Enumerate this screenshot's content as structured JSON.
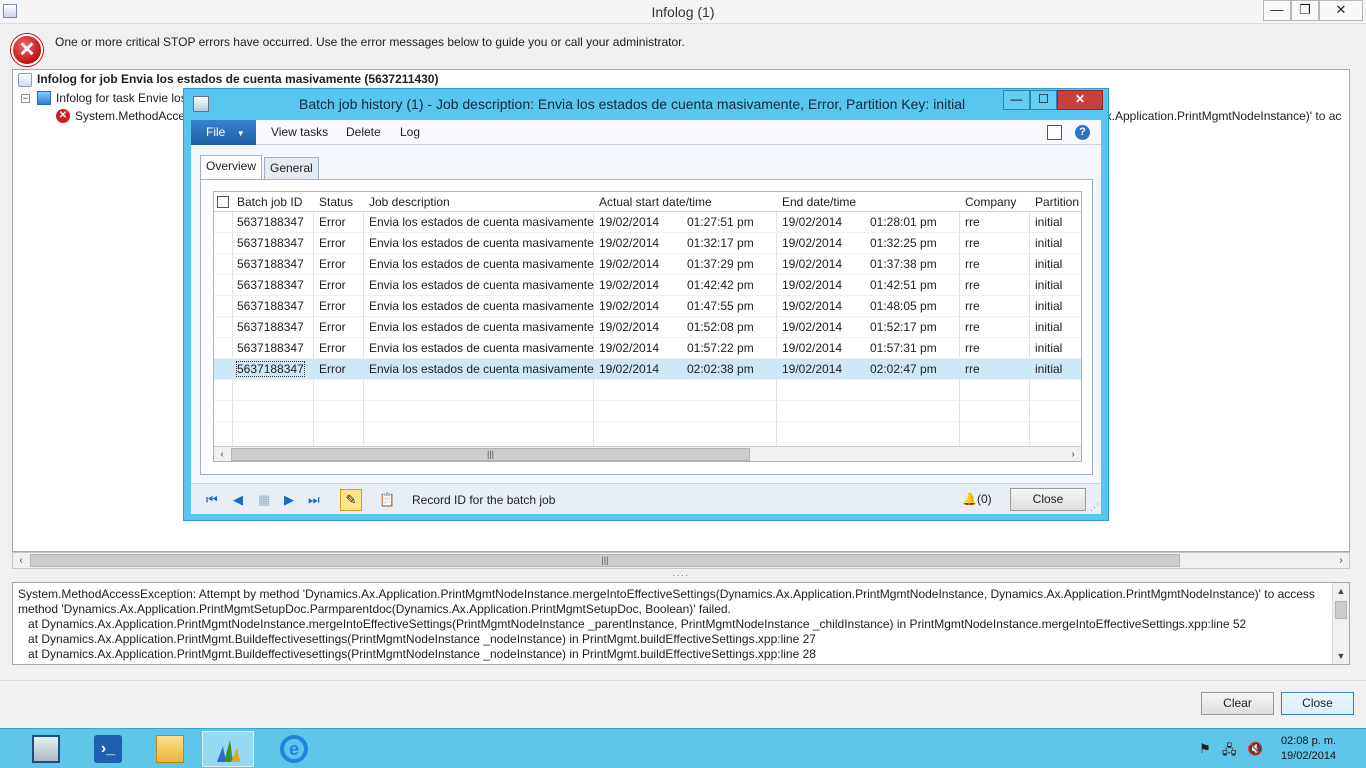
{
  "window": {
    "title": "Infolog (1)",
    "min_glyph": "—",
    "max_glyph": "❐",
    "close_glyph": "✕"
  },
  "stop_message": "One or more critical STOP errors have occurred. Use the error messages below to guide you or call your administrator.",
  "tree": {
    "job_node": "Infolog for job Envia los estados de cuenta masivamente (5637211430)",
    "task_node": "Infolog for task Envie los",
    "error_node": "System.MethodAccess",
    "error_tail": "ax.Application.PrintMgmtNodeInstance)' to ac"
  },
  "details": {
    "text": "System.MethodAccessException: Attempt by method 'Dynamics.Ax.Application.PrintMgmtNodeInstance.mergeIntoEffectiveSettings(Dynamics.Ax.Application.PrintMgmtNodeInstance, Dynamics.Ax.Application.PrintMgmtNodeInstance)' to access\nmethod 'Dynamics.Ax.Application.PrintMgmtSetupDoc.Parmparentdoc(Dynamics.Ax.Application.PrintMgmtSetupDoc, Boolean)' failed.\n   at Dynamics.Ax.Application.PrintMgmtNodeInstance.mergeIntoEffectiveSettings(PrintMgmtNodeInstance _parentInstance, PrintMgmtNodeInstance _childInstance) in PrintMgmtNodeInstance.mergeIntoEffectiveSettings.xpp:line 52\n   at Dynamics.Ax.Application.PrintMgmt.Buildeffectivesettings(PrintMgmtNodeInstance _nodeInstance) in PrintMgmt.buildEffectiveSettings.xpp:line 27\n   at Dynamics.Ax.Application.PrintMgmt.Buildeffectivesettings(PrintMgmtNodeInstance _nodeInstance) in PrintMgmt.buildEffectiveSettings.xpp:line 28"
  },
  "buttons": {
    "clear": "Clear",
    "close": "Close"
  },
  "dialog": {
    "title": "Batch job history (1) - Job description: Envia los estados de cuenta masivamente, Error, Partition Key: initial",
    "min_glyph": "—",
    "max_glyph": "☐",
    "close_glyph": "✕",
    "ribbon": {
      "file": "File",
      "file_arrow": "▼",
      "view_tasks": "View tasks",
      "delete": "Delete",
      "log": "Log",
      "help": "?"
    },
    "tabs": {
      "overview": "Overview",
      "general": "General"
    },
    "columns": {
      "batch_job_id": "Batch job ID",
      "status": "Status",
      "job_description": "Job description",
      "actual_start": "Actual start date/time",
      "end": "End date/time",
      "company": "Company",
      "partition": "Partition"
    },
    "rows": [
      {
        "id": "5637188347",
        "status": "Error",
        "desc": "Envia los estados de cuenta masivamente",
        "start_date": "19/02/2014",
        "start_time": "01:27:51 pm",
        "end_date": "19/02/2014",
        "end_time": "01:28:01 pm",
        "company": "rre",
        "partition": "initial"
      },
      {
        "id": "5637188347",
        "status": "Error",
        "desc": "Envia los estados de cuenta masivamente",
        "start_date": "19/02/2014",
        "start_time": "01:32:17 pm",
        "end_date": "19/02/2014",
        "end_time": "01:32:25 pm",
        "company": "rre",
        "partition": "initial"
      },
      {
        "id": "5637188347",
        "status": "Error",
        "desc": "Envia los estados de cuenta masivamente",
        "start_date": "19/02/2014",
        "start_time": "01:37:29 pm",
        "end_date": "19/02/2014",
        "end_time": "01:37:38 pm",
        "company": "rre",
        "partition": "initial"
      },
      {
        "id": "5637188347",
        "status": "Error",
        "desc": "Envia los estados de cuenta masivamente",
        "start_date": "19/02/2014",
        "start_time": "01:42:42 pm",
        "end_date": "19/02/2014",
        "end_time": "01:42:51 pm",
        "company": "rre",
        "partition": "initial"
      },
      {
        "id": "5637188347",
        "status": "Error",
        "desc": "Envia los estados de cuenta masivamente",
        "start_date": "19/02/2014",
        "start_time": "01:47:55 pm",
        "end_date": "19/02/2014",
        "end_time": "01:48:05 pm",
        "company": "rre",
        "partition": "initial"
      },
      {
        "id": "5637188347",
        "status": "Error",
        "desc": "Envia los estados de cuenta masivamente",
        "start_date": "19/02/2014",
        "start_time": "01:52:08 pm",
        "end_date": "19/02/2014",
        "end_time": "01:52:17 pm",
        "company": "rre",
        "partition": "initial"
      },
      {
        "id": "5637188347",
        "status": "Error",
        "desc": "Envia los estados de cuenta masivamente",
        "start_date": "19/02/2014",
        "start_time": "01:57:22 pm",
        "end_date": "19/02/2014",
        "end_time": "01:57:31 pm",
        "company": "rre",
        "partition": "initial"
      },
      {
        "id": "5637188347",
        "status": "Error",
        "desc": "Envia los estados de cuenta masivamente",
        "start_date": "19/02/2014",
        "start_time": "02:02:38 pm",
        "end_date": "19/02/2014",
        "end_time": "02:02:47 pm",
        "company": "rre",
        "partition": "initial"
      }
    ],
    "selected_row": 7,
    "status_text": "Record ID for the batch job",
    "notifications": "(0)",
    "close": "Close"
  },
  "taskbar": {
    "items": [
      "server-manager",
      "powershell",
      "file-explorer",
      "dynamics-ax",
      "internet-explorer"
    ],
    "active": "dynamics-ax",
    "time": "02:08 p. m.",
    "date": "19/02/2014"
  },
  "colors": {
    "dialog_frame": "#59c6ef",
    "taskbar": "#5fc6ea",
    "selection": "#cde8f6",
    "error_red": "#d21d1d"
  }
}
